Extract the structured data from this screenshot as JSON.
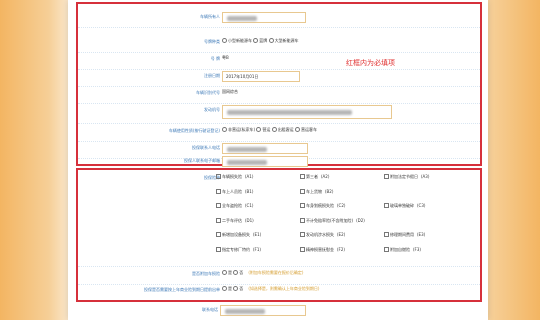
{
  "form": {
    "name_label": "车辆所有人",
    "platetype_label": "号牌种类",
    "platetype_options": [
      "小型新能源车",
      "蓝牌",
      "大型新能源车"
    ],
    "platenum_label": "号  牌",
    "platenum_value": "粤B",
    "regdate_label": "注册日期",
    "regdate_value": "2017年10月01日",
    "vin_label": "车辆识别代号",
    "vin_value": "国网综合",
    "engine_label": "发动机号",
    "usage_label": "车辆使用性质(按行驶证登记)",
    "usage_options": [
      "非营运(私家车)",
      "营运",
      "出租客运",
      "营运客车"
    ],
    "contact_label": "投保联系人电话",
    "email_label": "投保人联系电子邮箱",
    "required_note": "红框内为必填项"
  },
  "insurance": {
    "section_label": "投保险种",
    "items": [
      {
        "label": "车辆损失险",
        "code": "(A1)"
      },
      {
        "label": "第三者",
        "code": "(A2)"
      },
      {
        "label": "附加法定节假日",
        "code": "(A3)"
      },
      {
        "label": "车上人员险",
        "code": "(B1)"
      },
      {
        "label": "车上货物",
        "code": "(B2)"
      },
      {
        "label": "",
        "code": ""
      },
      {
        "label": "全车盗抢险",
        "code": "(C1)"
      },
      {
        "label": "车身划痕损失险",
        "code": "(C2)"
      },
      {
        "label": "玻璃单独破碎",
        "code": "(C3)"
      },
      {
        "label": "二手车评估",
        "code": "(D1)"
      },
      {
        "label": "不计免赔率险(不含附加险)",
        "code": "(D2)"
      },
      {
        "label": "",
        "code": ""
      },
      {
        "label": "新增加设备损失",
        "code": "(E1)"
      },
      {
        "label": "发动机涉水损失",
        "code": "(E2)"
      },
      {
        "label": "修理期间费用",
        "code": "(E3)"
      },
      {
        "label": "指定专修厂特约",
        "code": "(F1)"
      },
      {
        "label": "精神损害抚慰金",
        "code": "(F2)"
      },
      {
        "label": "附加自燃险",
        "code": "(F3)"
      }
    ],
    "vehicle_loss_label": "是否附加车损险",
    "vehicle_loss_options": [
      "是",
      "否"
    ],
    "vehicle_loss_tip": "(附加车损险需要在报价后确定)",
    "renew_label": "投保是否需要按上年商业险到期日提前出单",
    "renew_options": [
      "是",
      "否"
    ],
    "renew_tip": "(如选择是，则需确认上年商业险到期日)",
    "contact_label": "联系电话"
  }
}
